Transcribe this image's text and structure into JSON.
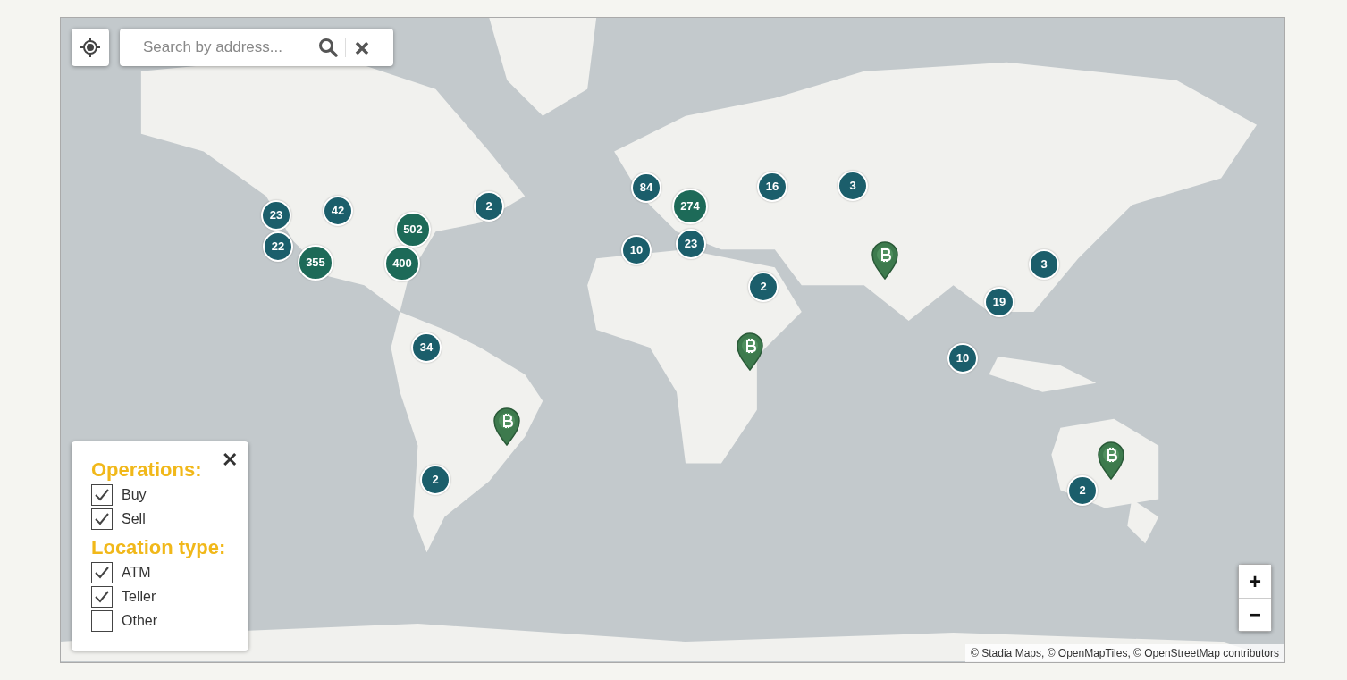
{
  "search": {
    "placeholder": "Search by address..."
  },
  "markers": [
    {
      "kind": "cluster",
      "count": "23",
      "color": "#1b5e6b"
    },
    {
      "kind": "cluster",
      "count": "42",
      "color": "#1b5e6b"
    },
    {
      "kind": "cluster",
      "count": "22",
      "color": "#1b5e6b"
    },
    {
      "kind": "cluster",
      "count": "355",
      "color": "#1d6a58"
    },
    {
      "kind": "cluster",
      "count": "502",
      "color": "#1d6a58"
    },
    {
      "kind": "cluster",
      "count": "400",
      "color": "#1d6a58"
    },
    {
      "kind": "cluster",
      "count": "2",
      "color": "#1b5e6b"
    },
    {
      "kind": "cluster",
      "count": "34",
      "color": "#1b5e6b"
    },
    {
      "kind": "cluster",
      "count": "2",
      "color": "#1b5e6b"
    },
    {
      "kind": "cluster",
      "count": "84",
      "color": "#1b5e6b"
    },
    {
      "kind": "cluster",
      "count": "274",
      "color": "#1d6a58"
    },
    {
      "kind": "cluster",
      "count": "10",
      "color": "#1b5e6b"
    },
    {
      "kind": "cluster",
      "count": "23",
      "color": "#1b5e6b"
    },
    {
      "kind": "cluster",
      "count": "16",
      "color": "#1b5e6b"
    },
    {
      "kind": "cluster",
      "count": "3",
      "color": "#1b5e6b"
    },
    {
      "kind": "cluster",
      "count": "2",
      "color": "#1b5e6b"
    },
    {
      "kind": "cluster",
      "count": "3",
      "color": "#1b5e6b"
    },
    {
      "kind": "cluster",
      "count": "19",
      "color": "#1b5e6b"
    },
    {
      "kind": "cluster",
      "count": "10",
      "color": "#1b5e6b"
    },
    {
      "kind": "cluster",
      "count": "2",
      "color": "#1b5e6b"
    },
    {
      "kind": "pin"
    },
    {
      "kind": "pin"
    },
    {
      "kind": "pin"
    },
    {
      "kind": "pin"
    }
  ],
  "filters": {
    "close": "✕",
    "groups": [
      {
        "title": "Operations:",
        "options": [
          {
            "label": "Buy",
            "checked": true
          },
          {
            "label": "Sell",
            "checked": true
          }
        ]
      },
      {
        "title": "Location type:",
        "options": [
          {
            "label": "ATM",
            "checked": true
          },
          {
            "label": "Teller",
            "checked": true
          },
          {
            "label": "Other",
            "checked": false
          }
        ]
      }
    ]
  },
  "zoom": {
    "in": "+",
    "out": "−"
  },
  "attribution": "© Stadia Maps, © OpenMapTiles, © OpenStreetMap contributors"
}
